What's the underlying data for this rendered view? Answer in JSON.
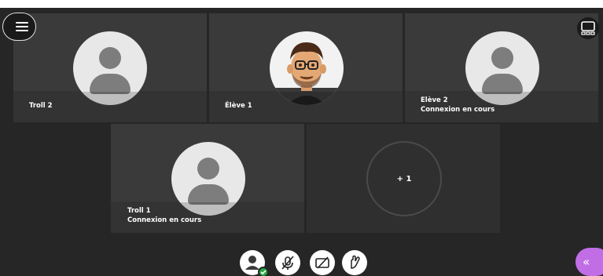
{
  "colors": {
    "page_bg": "#262626",
    "tile_bg": "#3a3a3a",
    "avatar_bg": "#e8e8e8",
    "accent_purple": "#c16ee6",
    "status_green": "#27a844"
  },
  "header": {
    "menu_icon": "hamburger-icon",
    "layout_icon": "layout-grid-icon"
  },
  "participants": [
    {
      "name": "Troll 2",
      "status": ""
    },
    {
      "name": "Élève 1",
      "status": ""
    },
    {
      "name": "Elève 2",
      "status": "Connexion en cours"
    },
    {
      "name": "Troll 1",
      "status": "Connexion en cours"
    }
  ],
  "overflow": {
    "label": "+ 1"
  },
  "controls": {
    "status_icon": "user-status-icon",
    "mic_icon": "microphone-off-icon",
    "camera_icon": "camera-off-icon",
    "hand_icon": "raise-hand-icon",
    "collapse_icon": "chevron-left-icon",
    "collapse_glyph": "«"
  }
}
